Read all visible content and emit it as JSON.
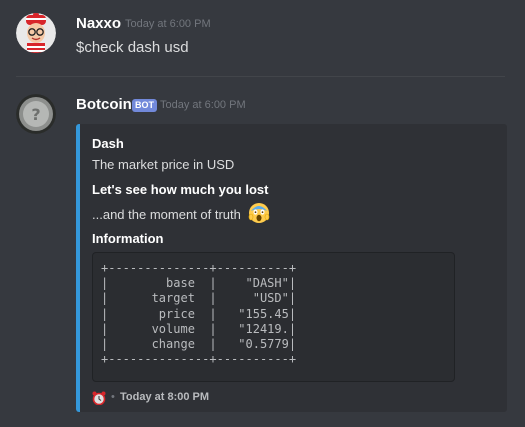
{
  "messages": [
    {
      "author": "Naxxo",
      "timestamp": "Today at 6:00 PM",
      "content": "$check dash usd"
    },
    {
      "author": "Botcoin",
      "bot_tag": "BOT",
      "timestamp": "Today at 6:00 PM",
      "embed": {
        "accent_color": "#3498db",
        "title": "Dash",
        "description": "The market price in USD",
        "fields": [
          {
            "name": "Let's see how much you lost",
            "value": "...and the moment of truth",
            "emoji": "scream-emoji"
          },
          {
            "name": "Information"
          }
        ],
        "code_table": "+--------------+----------+\n|        base  |    \"DASH\"|\n|      target  |     \"USD\"|\n|       price  |   \"155.45|\n|      volume  |   \"12419.|\n|      change  |   \"0.5779|\n+--------------+----------+",
        "footer": {
          "icon": "alarm-clock-icon",
          "separator": "•",
          "text": "Today at 8:00 PM"
        }
      }
    }
  ]
}
